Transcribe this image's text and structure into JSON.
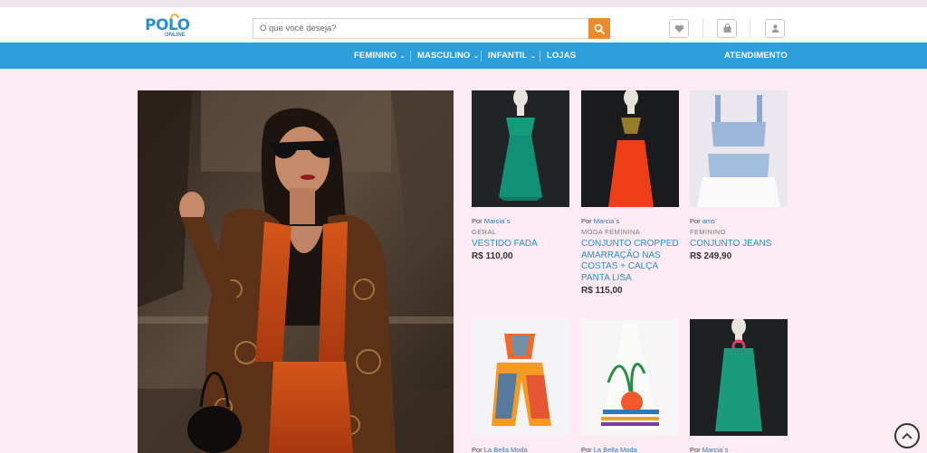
{
  "header": {
    "logo_text": "POLO",
    "logo_subtext": "ONLINE",
    "search": {
      "placeholder": "O que você deseja?",
      "value": ""
    },
    "icons": [
      "heart-icon",
      "bag-icon",
      "user-icon"
    ]
  },
  "nav": {
    "items": [
      {
        "label": "FEMININO",
        "has_dropdown": true
      },
      {
        "label": "MASCULINO",
        "has_dropdown": true
      },
      {
        "label": "INFANTIL",
        "has_dropdown": true
      },
      {
        "label": "LOJAS",
        "has_dropdown": false
      }
    ],
    "support": "ATENDIMENTO"
  },
  "products": [
    {
      "by_prefix": "Por",
      "vendor": "Marcia´s",
      "category": "GERAL",
      "name": "VESTIDO FADA",
      "price": "R$ 110,00"
    },
    {
      "by_prefix": "Por",
      "vendor": "Marcia´s",
      "category": "MODA FEMININA",
      "name": "CONJUNTO CROPPED AMARRAÇÃO NAS COSTAS + CALÇA PANTA LISA",
      "price": "R$ 115,00"
    },
    {
      "by_prefix": "Por",
      "vendor": "ams",
      "category": "FEMININO",
      "name": "CONJUNTO JEANS",
      "price": "R$ 249,90"
    },
    {
      "by_prefix": "Por",
      "vendor": "La Bella Moda"
    },
    {
      "by_prefix": "Por",
      "vendor": "La Bella Moda"
    },
    {
      "by_prefix": "Por",
      "vendor": "Marcia´s"
    }
  ],
  "colors": {
    "accent_blue": "#2d9ed9",
    "search_orange": "#ec8a2e",
    "page_background": "#fcebf3",
    "link_blue": "#2b8fc9"
  }
}
